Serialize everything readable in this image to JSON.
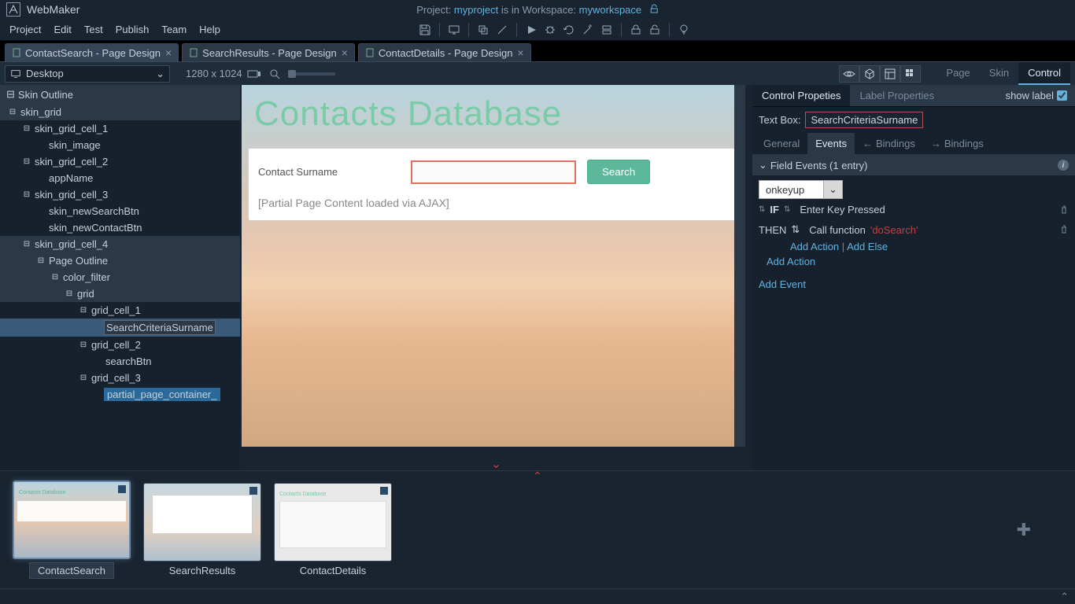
{
  "app": {
    "name": "WebMaker"
  },
  "project": {
    "prefix": "Project:",
    "name": "myproject",
    "mid": "is in Workspace:",
    "workspace": "myworkspace"
  },
  "menus": [
    "Project",
    "Edit",
    "Test",
    "Publish",
    "Team",
    "Help"
  ],
  "doc_tabs": [
    {
      "label": "ContactSearch - Page Design",
      "active": true
    },
    {
      "label": "SearchResults - Page Design",
      "active": false
    },
    {
      "label": "ContactDetails - Page Design",
      "active": false
    }
  ],
  "device": {
    "selected": "Desktop",
    "dimensions": "1280 x 1024"
  },
  "right_main_tabs": [
    "Page",
    "Skin",
    "Control"
  ],
  "right_main_active": "Control",
  "skin_outline": {
    "header": "Skin Outline",
    "nodes": [
      {
        "depth": 0,
        "label": "skin_grid",
        "exp": true,
        "hl": true
      },
      {
        "depth": 1,
        "label": "skin_grid_cell_1",
        "exp": true
      },
      {
        "depth": 2,
        "label": "skin_image"
      },
      {
        "depth": 1,
        "label": "skin_grid_cell_2",
        "exp": true
      },
      {
        "depth": 2,
        "label": "appName"
      },
      {
        "depth": 1,
        "label": "skin_grid_cell_3",
        "exp": true
      },
      {
        "depth": 2,
        "label": "skin_newSearchBtn"
      },
      {
        "depth": 2,
        "label": "skin_newContactBtn"
      },
      {
        "depth": 1,
        "label": "skin_grid_cell_4",
        "exp": true,
        "hl": true
      },
      {
        "depth": 2,
        "label": "Page Outline",
        "exp": true,
        "isHeader": true
      },
      {
        "depth": 3,
        "label": "color_filter",
        "exp": true,
        "hl": true
      },
      {
        "depth": 4,
        "label": "grid",
        "exp": true,
        "hl": true
      },
      {
        "depth": 5,
        "label": "grid_cell_1",
        "exp": true
      },
      {
        "depth": 6,
        "label": "SearchCriteriaSurname",
        "selected": true,
        "boxed": true
      },
      {
        "depth": 5,
        "label": "grid_cell_2",
        "exp": true
      },
      {
        "depth": 6,
        "label": "searchBtn"
      },
      {
        "depth": 5,
        "label": "grid_cell_3",
        "exp": true
      },
      {
        "depth": 6,
        "label": "partial_page_container_",
        "trunc": true
      }
    ]
  },
  "canvas": {
    "title": "Contacts Database",
    "search_label": "Contact Surname",
    "search_button": "Search",
    "partial_note": "[Partial Page Content loaded via AJAX]"
  },
  "props": {
    "tabs": [
      "Control Propeties",
      "Label Properties"
    ],
    "active_tab": "Control Propeties",
    "show_label": "show label",
    "field_type": "Text Box:",
    "field_name": "SearchCriteriaSurname",
    "sub_tabs": [
      "General",
      "Events",
      "Bindings",
      "Bindings"
    ],
    "sub_active": "Events",
    "events_header": "Field Events (1 entry)",
    "event_selected": "onkeyup",
    "if_label": "IF",
    "if_cond": "Enter Key Pressed",
    "then_label": "THEN",
    "then_prefix": "Call function",
    "then_fn": "'doSearch'",
    "add_action": "Add Action",
    "add_else": "Add Else",
    "add_action2": "Add Action",
    "add_event": "Add Event"
  },
  "thumbnails": [
    {
      "caption": "ContactSearch",
      "active": true
    },
    {
      "caption": "SearchResults",
      "active": false
    },
    {
      "caption": "ContactDetails",
      "active": false
    }
  ]
}
